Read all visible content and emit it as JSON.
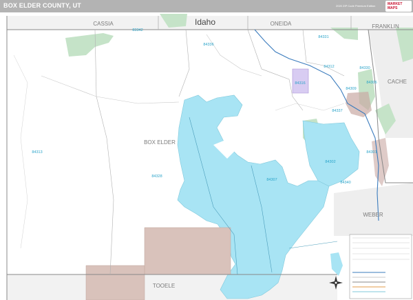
{
  "header": {
    "title": "BOX ELDER COUNTY, UT",
    "edition": "2020 ZIP Code Premium Edition",
    "logo_text": "MARKET MAPS"
  },
  "map": {
    "state_label": "Idaho",
    "county_labels": {
      "box_elder": "BOX ELDER",
      "cassia": "CASSIA",
      "oneida": "ONEIDA",
      "franklin": "FRANKLIN",
      "cache": "CACHE",
      "weber": "WEBER",
      "tooele": "TOOELE"
    },
    "zip_labels": {
      "z84313": "84313",
      "z84336": "84336",
      "z84331": "84331",
      "z84312": "84312",
      "z84316": "84316",
      "z84307": "84307",
      "z84328": "84328",
      "z84301": "84301",
      "z84302": "84302",
      "z84340": "84340",
      "z84306": "84306",
      "z84309": "84309",
      "z84337": "84337",
      "z83342": "83342",
      "z84330": "84330"
    },
    "colors": {
      "lake": "#a8e4f4",
      "forest": "#c5e3c8",
      "reservation": "#d9c2bb",
      "urban": "#c9a9a4",
      "zip_text": "#29a3c9",
      "county_text": "#7a7a7a",
      "header": "#b3b3b3"
    },
    "icons": [
      "compass-rose-icon",
      "market-maps-logo-icon"
    ]
  }
}
